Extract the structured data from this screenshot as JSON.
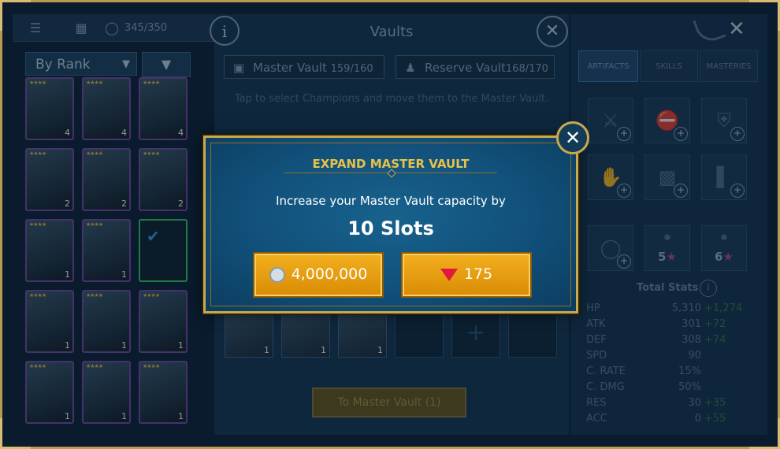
{
  "left_panel": {
    "capacity": "345/350",
    "filter_label": "By Rank",
    "cards": [
      {
        "level": "4",
        "selected": false
      },
      {
        "level": "4",
        "selected": false
      },
      {
        "level": "4",
        "selected": false
      },
      {
        "level": "2",
        "selected": false
      },
      {
        "level": "2",
        "selected": false
      },
      {
        "level": "2",
        "selected": false
      },
      {
        "level": "1",
        "selected": false
      },
      {
        "level": "1",
        "selected": false
      },
      {
        "level": "",
        "selected": true
      },
      {
        "level": "1",
        "selected": false
      },
      {
        "level": "1",
        "selected": false
      },
      {
        "level": "1",
        "selected": false
      },
      {
        "level": "1",
        "selected": false
      },
      {
        "level": "1",
        "selected": false
      },
      {
        "level": "1",
        "selected": false
      }
    ]
  },
  "vault": {
    "title": "Vaults",
    "master_tab": {
      "label": "Master Vault",
      "count": "159/160"
    },
    "reserve_tab": {
      "label": "Reserve Vault",
      "count": "168/170"
    },
    "hint": "Tap to select Champions and move them to the Master Vault.",
    "slot_levels": [
      "1",
      "1",
      "1"
    ],
    "to_master_button": "To Master Vault (1)"
  },
  "right_panel": {
    "tabs": [
      "ARTIFACTS",
      "SKILLS",
      "MASTERIES"
    ],
    "active_tab": "ARTIFACTS",
    "accessory_counts": [
      "5",
      "6"
    ],
    "total_stats_title": "Total Stats",
    "stats": [
      {
        "label": "HP",
        "value": "5,310",
        "bonus": "+1,274"
      },
      {
        "label": "ATK",
        "value": "301",
        "bonus": "+72"
      },
      {
        "label": "DEF",
        "value": "308",
        "bonus": "+74"
      },
      {
        "label": "SPD",
        "value": "90",
        "bonus": ""
      },
      {
        "label": "C. RATE",
        "value": "15%",
        "bonus": ""
      },
      {
        "label": "C. DMG",
        "value": "50%",
        "bonus": ""
      },
      {
        "label": "RES",
        "value": "30",
        "bonus": "+35"
      },
      {
        "label": "ACC",
        "value": "0",
        "bonus": "+55"
      }
    ]
  },
  "modal": {
    "title": "EXPAND MASTER VAULT",
    "description": "Increase your Master Vault capacity by",
    "slots_text": "10 Slots",
    "silver_price": "4,000,000",
    "ruby_price": "175",
    "silver_icon": "silver-coin-icon",
    "ruby_icon": "ruby-gem-icon"
  },
  "colors": {
    "gold_accent": "#e8c24a",
    "button_gold": "#f2b01e",
    "modal_blue": "#11507a"
  }
}
